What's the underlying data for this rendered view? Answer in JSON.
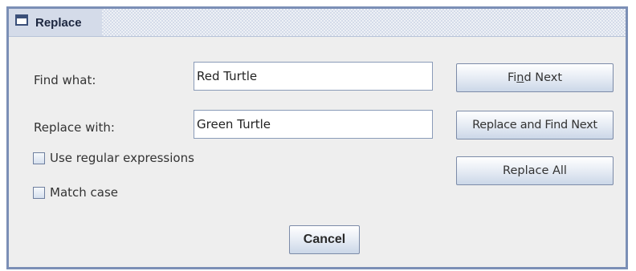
{
  "window": {
    "title": "Replace"
  },
  "find": {
    "label": "Find what:",
    "value": "Red Turtle"
  },
  "replace": {
    "label": "Replace with:",
    "value": "Green Turtle"
  },
  "options": {
    "regex_label": "Use regular expressions",
    "regex_checked": false,
    "match_case_label": "Match case",
    "match_case_checked": false
  },
  "buttons": {
    "find_next_pre": "Fi",
    "find_next_mnemonic": "n",
    "find_next_post": "d Next",
    "replace_find_next": "Replace and Find Next",
    "replace_all": "Replace All",
    "cancel": "Cancel"
  },
  "colors": {
    "border": "#7b8fb6",
    "dialog_bg": "#eeeeee",
    "title_text": "#1d2740"
  },
  "icons": {
    "title": "window-icon"
  }
}
